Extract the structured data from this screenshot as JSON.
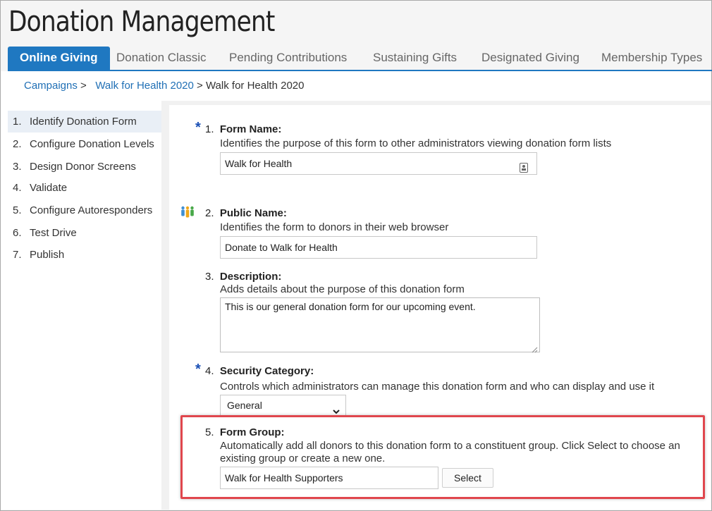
{
  "app_title": "Donation Management",
  "tabs": [
    {
      "label": "Online Giving",
      "active": true
    },
    {
      "label": "Donation Classic"
    },
    {
      "label": "Pending Contributions"
    },
    {
      "label": "Sustaining Gifts"
    },
    {
      "label": "Designated Giving"
    },
    {
      "label": "Membership Types"
    }
  ],
  "breadcrumb": {
    "items": [
      "Campaigns",
      "Walk for Health 2020"
    ],
    "separator": ">",
    "current": "Walk for Health 2020"
  },
  "steps": [
    {
      "num": "1.",
      "label": "Identify Donation Form",
      "active": true
    },
    {
      "num": "2.",
      "label": "Configure Donation Levels"
    },
    {
      "num": "3.",
      "label": "Design Donor Screens"
    },
    {
      "num": "4.",
      "label": "Validate"
    },
    {
      "num": "5.",
      "label": "Configure Autoresponders"
    },
    {
      "num": "6.",
      "label": "Test Drive"
    },
    {
      "num": "7.",
      "label": "Publish"
    }
  ],
  "form": {
    "required_mark": "*",
    "form_name": {
      "num": "1.",
      "label": "Form Name:",
      "hint": "Identifies the purpose of this form to other administrators viewing donation form lists",
      "value": "Walk for Health"
    },
    "public_name": {
      "num": "2.",
      "label": "Public Name:",
      "hint": "Identifies the form to donors in their web browser",
      "value": "Donate to Walk for Health"
    },
    "description": {
      "num": "3.",
      "label": "Description:",
      "hint": "Adds details about the purpose of this donation form",
      "value": "This is our general donation form for our upcoming event."
    },
    "security_category": {
      "num": "4.",
      "label": "Security Category:",
      "hint": "Controls which administrators can manage this donation form and who can display and use it",
      "value": "General"
    },
    "form_group": {
      "num": "5.",
      "label": "Form Group:",
      "hint_line1": "Automatically add all donors to this donation form to a constituent group. Click Select to choose an",
      "hint_line2": "existing group or create a new one.",
      "value": "Walk for Health Supporters",
      "button": "Select"
    }
  },
  "colors": {
    "accent": "#1f78c1",
    "link": "#1f6fb5",
    "highlight": "#e0464d",
    "required": "#1a4fb5"
  }
}
